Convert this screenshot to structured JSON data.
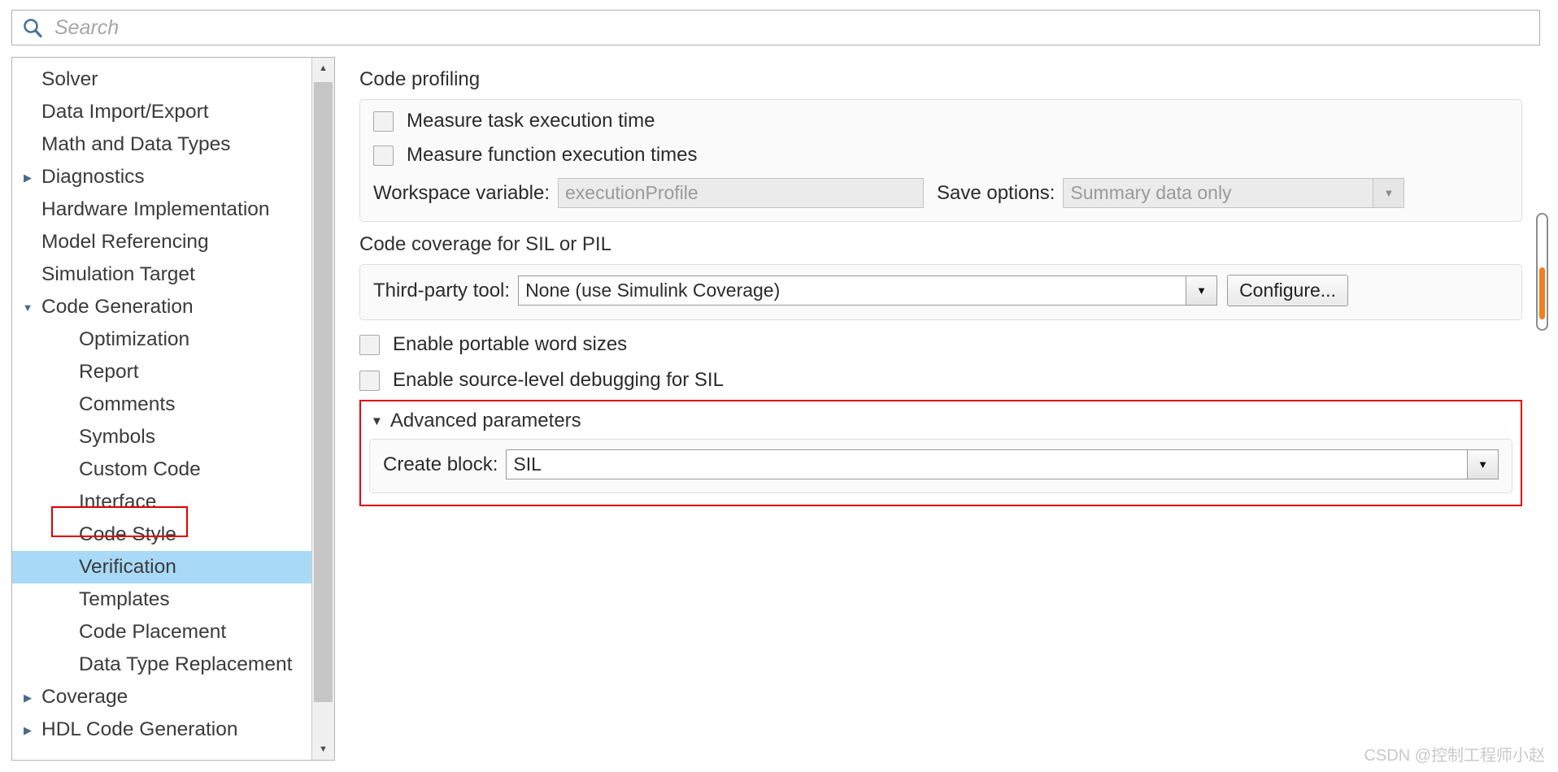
{
  "search": {
    "placeholder": "Search",
    "icon": "search-icon"
  },
  "sidebar": {
    "items": [
      {
        "label": "Solver",
        "depth": 0,
        "arrow": "",
        "selected": false
      },
      {
        "label": "Data Import/Export",
        "depth": 0,
        "arrow": "",
        "selected": false
      },
      {
        "label": "Math and Data Types",
        "depth": 0,
        "arrow": "",
        "selected": false
      },
      {
        "label": "Diagnostics",
        "depth": 0,
        "arrow": "▶",
        "selected": false
      },
      {
        "label": "Hardware Implementation",
        "depth": 0,
        "arrow": "",
        "selected": false
      },
      {
        "label": "Model Referencing",
        "depth": 0,
        "arrow": "",
        "selected": false
      },
      {
        "label": "Simulation Target",
        "depth": 0,
        "arrow": "",
        "selected": false
      },
      {
        "label": "Code Generation",
        "depth": 0,
        "arrow": "▼",
        "selected": false
      },
      {
        "label": "Optimization",
        "depth": 1,
        "arrow": "",
        "selected": false
      },
      {
        "label": "Report",
        "depth": 1,
        "arrow": "",
        "selected": false
      },
      {
        "label": "Comments",
        "depth": 1,
        "arrow": "",
        "selected": false
      },
      {
        "label": "Symbols",
        "depth": 1,
        "arrow": "",
        "selected": false
      },
      {
        "label": "Custom Code",
        "depth": 1,
        "arrow": "",
        "selected": false
      },
      {
        "label": "Interface",
        "depth": 1,
        "arrow": "",
        "selected": false
      },
      {
        "label": "Code Style",
        "depth": 1,
        "arrow": "",
        "selected": false
      },
      {
        "label": "Verification",
        "depth": 1,
        "arrow": "",
        "selected": true
      },
      {
        "label": "Templates",
        "depth": 1,
        "arrow": "",
        "selected": false
      },
      {
        "label": "Code Placement",
        "depth": 1,
        "arrow": "",
        "selected": false
      },
      {
        "label": "Data Type Replacement",
        "depth": 1,
        "arrow": "",
        "selected": false
      },
      {
        "label": "Coverage",
        "depth": 0,
        "arrow": "▶",
        "selected": false
      },
      {
        "label": "HDL Code Generation",
        "depth": 0,
        "arrow": "▶",
        "selected": false
      }
    ],
    "scrollbar": {
      "up_icon": "chevron-up-icon",
      "down_icon": "chevron-down-icon"
    }
  },
  "code_profiling": {
    "title": "Code profiling",
    "measure_task": {
      "label": "Measure task execution time",
      "checked": false
    },
    "measure_function": {
      "label": "Measure function execution times",
      "checked": false
    },
    "workspace_variable": {
      "label": "Workspace variable:",
      "value": "executionProfile",
      "enabled": false
    },
    "save_options": {
      "label": "Save options:",
      "value": "Summary data only",
      "enabled": false,
      "arrow_icon": "chevron-down-icon"
    }
  },
  "code_coverage": {
    "title": "Code coverage for SIL or PIL",
    "third_party_tool": {
      "label": "Third-party tool:",
      "value": "None (use Simulink Coverage)",
      "enabled": true,
      "arrow_icon": "chevron-down-icon"
    },
    "configure_button": "Configure..."
  },
  "options": {
    "portable_word_sizes": {
      "label": "Enable portable word sizes",
      "checked": false
    },
    "source_level_debugging": {
      "label": "Enable source-level debugging for SIL",
      "checked": false
    }
  },
  "advanced": {
    "title": "Advanced parameters",
    "expanded_icon": "triangle-down-icon",
    "create_block": {
      "label": "Create block:",
      "value": "SIL",
      "enabled": true,
      "arrow_icon": "chevron-down-icon"
    }
  },
  "annotations": {
    "accent_color": "#e00000",
    "selection_color": "#a8daf7",
    "scroll_marker_color": "#f08020"
  },
  "watermark": "CSDN @控制工程师小赵"
}
